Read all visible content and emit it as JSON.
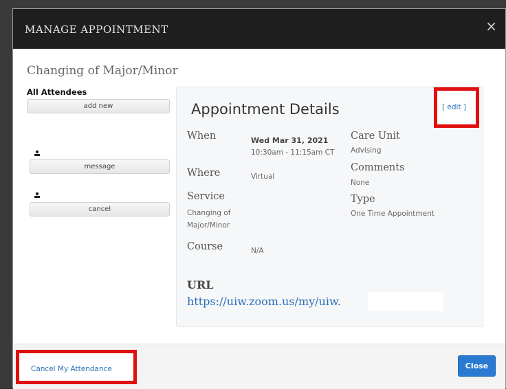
{
  "modal": {
    "title": "MANAGE APPOINTMENT",
    "close_symbol": "×",
    "subject": "Changing of Major/Minor"
  },
  "attendees": {
    "label": "All Attendees",
    "add_new": "add new",
    "message": "message",
    "cancel": "cancel"
  },
  "details": {
    "title": "Appointment Details",
    "edit": "[ edit ]",
    "when_label": "When",
    "when_date": "Wed Mar 31, 2021",
    "when_time": "10:30am - 11:15am CT",
    "where_label": "Where",
    "where_value": "Virtual",
    "service_label": "Service",
    "service_value": "Changing of Major/Minor",
    "course_label": "Course",
    "course_value": "N/A",
    "care_unit_label": "Care Unit",
    "care_unit_value": "Advising",
    "comments_label": "Comments",
    "comments_value": "None",
    "type_label": "Type",
    "type_value": "One Time Appointment",
    "url_label": "URL",
    "url_value": "https://uiw.zoom.us/my/uiw."
  },
  "footer": {
    "cancel_attendance": "Cancel My Attendance",
    "close": "Close"
  },
  "colors": {
    "header_bg": "#1f1f1f",
    "link": "#2a6ebb",
    "highlight": "#e01010",
    "primary_button": "#2a7ad2"
  }
}
